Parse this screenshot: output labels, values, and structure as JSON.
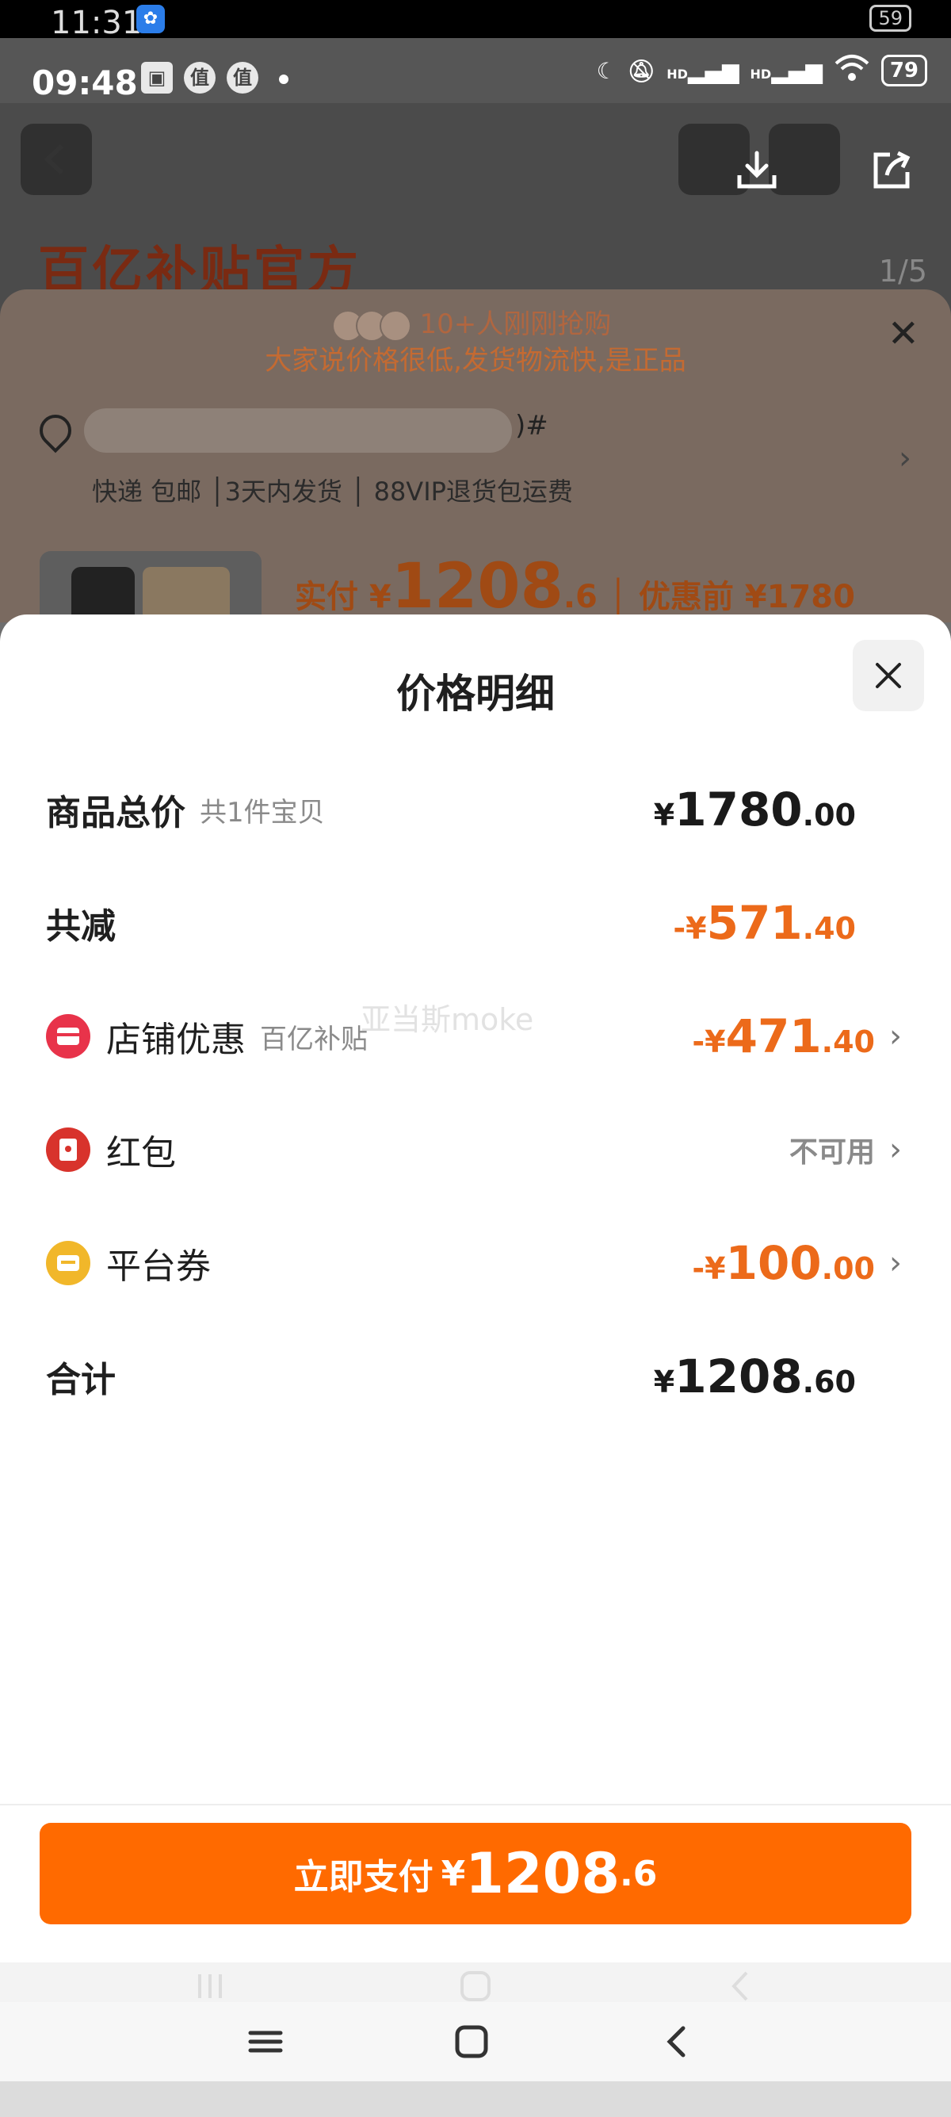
{
  "status_bar": {
    "time_old": "11:31",
    "time": "09:48",
    "notif_icons": [
      "值",
      "值"
    ],
    "signal_label": "HD",
    "battery_old": "59",
    "battery": "79"
  },
  "background_page": {
    "title": "百亿补贴官方",
    "image_counter": "1/5",
    "buyers_text": "10+人刚刚抢购",
    "comment_text": "大家说价格很低,发货物流快,是正品",
    "address_tail": ")#",
    "shipping_tags": "快递 包邮 │3天内发货 │ 88VIP退货包运费",
    "price_prefix": "实付 ¥",
    "price_int": "1208",
    "price_dec": ".6",
    "price_before": " │ 优惠前 ¥1780"
  },
  "detail": {
    "title": "价格明细",
    "rows": [
      {
        "label": "商品总价",
        "sub": "共1件宝贝",
        "cur": "¥",
        "int": "1780",
        "dec": ".00"
      },
      {
        "label": "共减",
        "cur": "-¥",
        "int": "571",
        "dec": ".40"
      },
      {
        "label": "店铺优惠",
        "sub": "百亿补贴",
        "cur": "-¥",
        "int": "471",
        "dec": ".40"
      },
      {
        "label": "红包",
        "value": "不可用"
      },
      {
        "label": "平台券",
        "cur": "-¥",
        "int": "100",
        "dec": ".00"
      },
      {
        "label": "合计",
        "cur": "¥",
        "int": "1208",
        "dec": ".60"
      }
    ],
    "watermark": "亚当斯moke"
  },
  "pay_button": {
    "label": "立即支付",
    "cur": "¥",
    "int": "1208",
    "dec": ".6"
  },
  "colors": {
    "accent": "#ff6a00",
    "discount": "#ec6a1a"
  },
  "icons": [
    "download-icon",
    "share-icon",
    "shop-coupon-icon",
    "red-packet-icon",
    "platform-coupon-icon",
    "close-icon",
    "chevron-right-icon"
  ]
}
